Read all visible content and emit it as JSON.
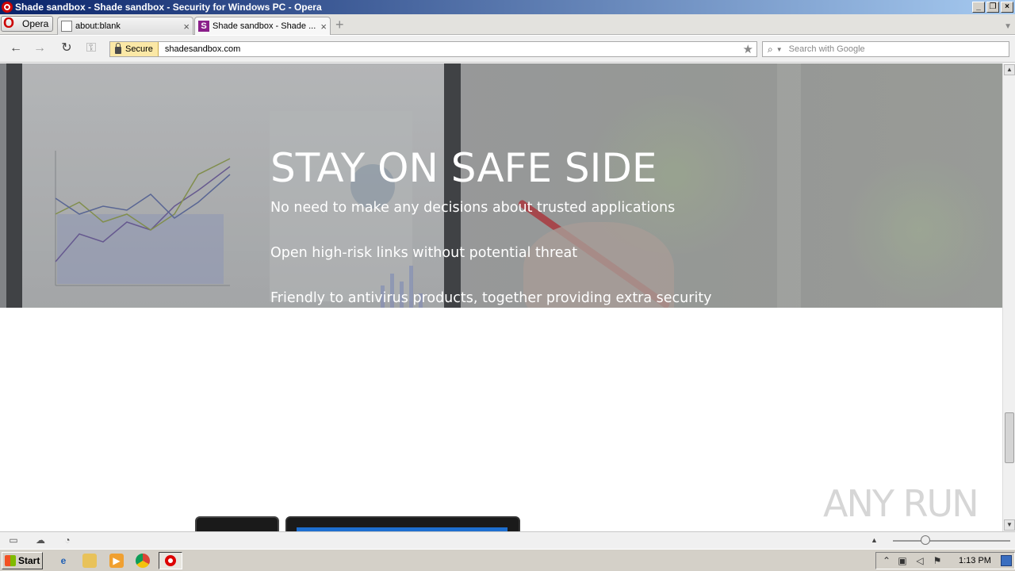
{
  "window": {
    "title": "Shade sandbox - Shade sandbox - Security for Windows PC - Opera",
    "controls": {
      "minimize": "_",
      "maximize": "❐",
      "close": "×"
    }
  },
  "browser": {
    "menu_label": "Opera",
    "tabs": [
      {
        "label": "about:blank",
        "active": false
      },
      {
        "label": "Shade sandbox - Shade ...",
        "active": true
      }
    ],
    "address": {
      "secure_label": "Secure",
      "url": "shadesandbox.com"
    },
    "search": {
      "placeholder": "Search with Google"
    }
  },
  "hero": {
    "title": "STAY ON SAFE SIDE",
    "lines": [
      "No need to make any decisions about trusted applications",
      "Open high-risk links without potential threat",
      "Friendly to antivirus products, together providing extra security"
    ]
  },
  "watermark": "ANY RUN",
  "taskbar": {
    "start_label": "Start",
    "clock": "1:13 PM"
  },
  "colors": {
    "title_gradient_start": "#0a246a",
    "title_gradient_end": "#a6caf0",
    "secure_bg": "#fbe8a6",
    "taskbar": "#d4d0c8"
  }
}
